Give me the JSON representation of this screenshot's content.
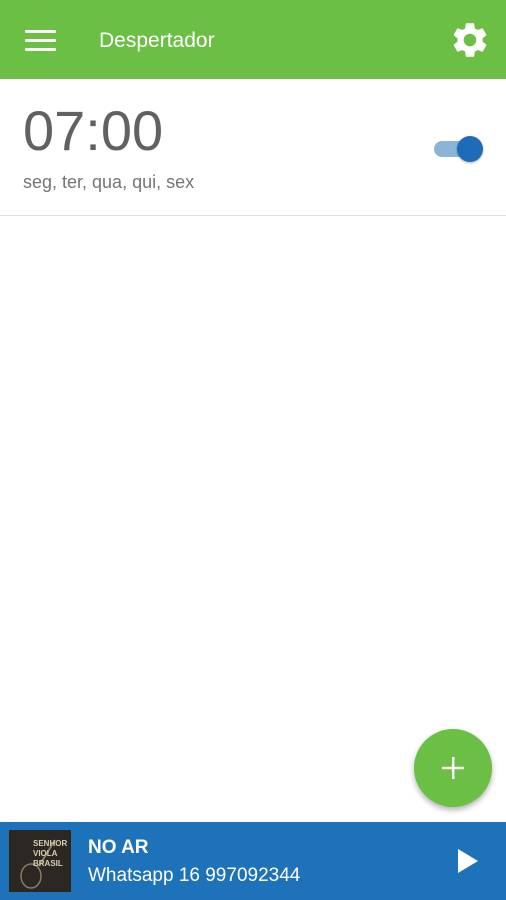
{
  "appbar": {
    "title": "Despertador",
    "menu_icon": "menu-icon",
    "settings_icon": "gear-icon",
    "color": "#6cbf45"
  },
  "alarms": [
    {
      "time": "07:00",
      "days": "seg, ter, qua, qui, sex",
      "enabled": true
    }
  ],
  "fab": {
    "icon": "plus-icon",
    "color": "#6cbf45"
  },
  "player": {
    "title": "NO AR",
    "subtitle": "Whatsapp 16 997092344",
    "cover_text": [
      "SENHOR",
      "VIOLA",
      "BRASIL"
    ],
    "play_icon": "play-icon",
    "color": "#1e72b9"
  },
  "colors": {
    "toggle_on_thumb": "#1e6bb8",
    "toggle_on_track": "#8ab4d8"
  }
}
